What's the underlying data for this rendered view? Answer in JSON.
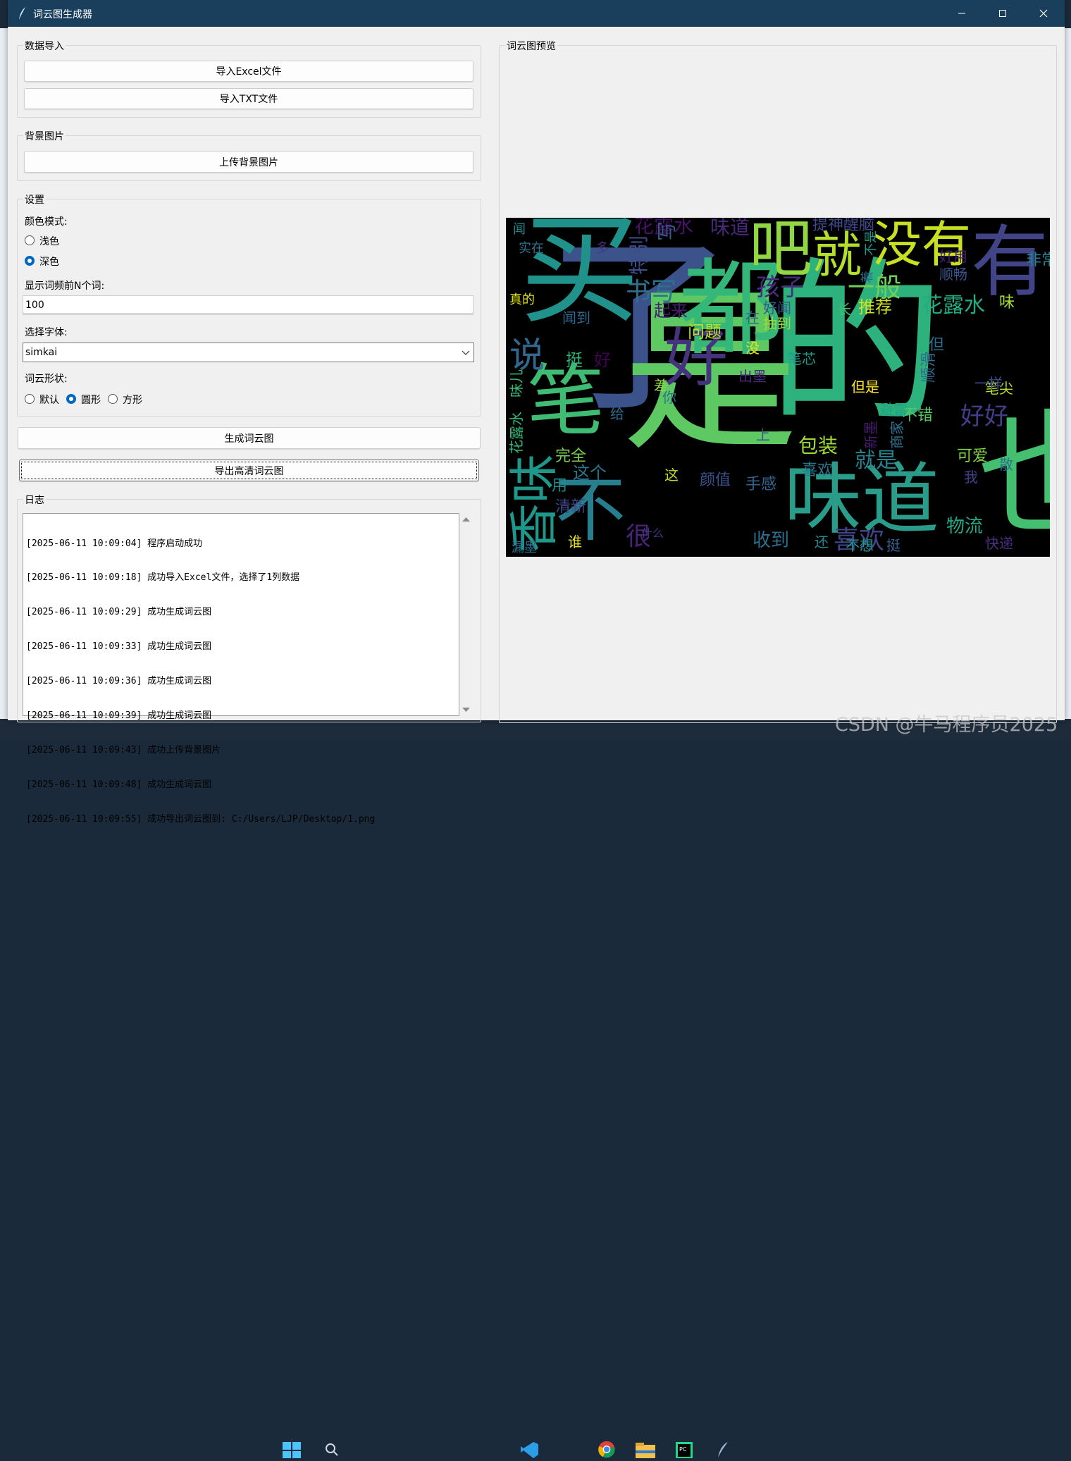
{
  "window": {
    "title": "词云图生成器"
  },
  "import_group": {
    "legend": "数据导入",
    "excel_button": "导入Excel文件",
    "txt_button": "导入TXT文件"
  },
  "bg_group": {
    "legend": "背景图片",
    "upload_button": "上传背景图片"
  },
  "settings": {
    "legend": "设置",
    "color_mode_label": "颜色模式:",
    "color_options": [
      {
        "label": "浅色",
        "selected": false
      },
      {
        "label": "深色",
        "selected": true
      }
    ],
    "topn_label": "显示词频前N个词:",
    "topn_value": "100",
    "font_label": "选择字体:",
    "font_value": "simkai",
    "shape_label": "词云形状:",
    "shape_options": [
      {
        "label": "默认",
        "selected": false
      },
      {
        "label": "圆形",
        "selected": true
      },
      {
        "label": "方形",
        "selected": false
      }
    ]
  },
  "actions": {
    "generate_button": "生成词云图",
    "export_button": "导出高清词云图"
  },
  "log": {
    "legend": "日志",
    "lines": [
      "[2025-06-11 10:09:04] 程序启动成功",
      "[2025-06-11 10:09:18] 成功导入Excel文件，选择了1列数据",
      "[2025-06-11 10:09:29] 成功生成词云图",
      "[2025-06-11 10:09:33] 成功生成词云图",
      "[2025-06-11 10:09:36] 成功生成词云图",
      "[2025-06-11 10:09:39] 成功生成词云图",
      "[2025-06-11 10:09:43] 成功上传背景图片",
      "[2025-06-11 10:09:48] 成功生成词云图",
      "[2025-06-11 10:09:55] 成功导出词云图到: C:/Users/LJP/Desktop/1.png"
    ]
  },
  "preview": {
    "legend": "词云图预览",
    "words": [
      {
        "t": "的",
        "c": "#2db27d"
      },
      {
        "t": "了",
        "c": "#3b528b"
      },
      {
        "t": "买",
        "c": "#21918c"
      },
      {
        "t": "是",
        "c": "#5ec962"
      },
      {
        "t": "都",
        "c": "#35b779"
      },
      {
        "t": "吧",
        "c": "#90d743"
      },
      {
        "t": "就",
        "c": "#b5de2b"
      },
      {
        "t": "没有",
        "c": "#c8e020"
      },
      {
        "t": "有",
        "c": "#414487"
      },
      {
        "t": "味道",
        "c": "#2a9d8a"
      },
      {
        "t": "笔",
        "c": "#3fbc73"
      },
      {
        "t": "不",
        "c": "#277f8e"
      },
      {
        "t": "也",
        "c": "#44bf70"
      },
      {
        "t": "好",
        "c": "#46337e"
      },
      {
        "t": "说",
        "c": "#31688e"
      },
      {
        "t": "香味",
        "c": "#1f988b"
      },
      {
        "t": "书写",
        "c": "#2c728e"
      },
      {
        "t": "孩子",
        "c": "#472d7b"
      },
      {
        "t": "一般",
        "c": "#6ece58"
      },
      {
        "t": "喜欢",
        "c": "#404688"
      },
      {
        "t": "花露水",
        "c": "#471365"
      },
      {
        "t": "味道",
        "c": "#482878"
      },
      {
        "t": "花露水",
        "c": "#25ab82"
      },
      {
        "t": "提神醒脑",
        "c": "#3e4989"
      },
      {
        "t": "推荐",
        "c": "#d0e11c"
      },
      {
        "t": "包装",
        "c": "#a2da37"
      },
      {
        "t": "就是",
        "c": "#26828e"
      },
      {
        "t": "物流",
        "c": "#22a884"
      },
      {
        "t": "收到",
        "c": "#2e6f8e"
      },
      {
        "t": "很",
        "c": "#482475"
      },
      {
        "t": "好好",
        "c": "#433e85"
      },
      {
        "t": "可爱",
        "c": "#86d549"
      },
      {
        "t": "颜值",
        "c": "#3b528b"
      },
      {
        "t": "手感",
        "c": "#33638d"
      },
      {
        "t": "喜欢",
        "c": "#29798e"
      },
      {
        "t": "完全",
        "c": "#7ad151"
      },
      {
        "t": "这个",
        "c": "#2a788e"
      },
      {
        "t": "清新",
        "c": "#3f4788"
      },
      {
        "t": "挺",
        "c": "#31b57b"
      },
      {
        "t": "好",
        "c": "#440154"
      },
      {
        "t": "问题",
        "c": "#bddf26"
      },
      {
        "t": "起来",
        "c": "#481f70"
      },
      {
        "t": "闻到",
        "c": "#306a8e"
      },
      {
        "t": "真的",
        "c": "#dfe318"
      },
      {
        "t": "实在",
        "c": "#2b748e"
      },
      {
        "t": "闻",
        "c": "#23888e"
      },
      {
        "t": "多",
        "c": "#453781"
      },
      {
        "t": "笔芯",
        "c": "#1e9b8a"
      },
      {
        "t": "但是",
        "c": "#fde725"
      },
      {
        "t": "笔尖",
        "c": "#b8de29"
      },
      {
        "t": "不错",
        "c": "#56c667"
      },
      {
        "t": "避雷",
        "c": "#20a486"
      },
      {
        "t": "顺滑",
        "c": "#2f6c8e"
      },
      {
        "t": "特别",
        "c": "#3d4e8a"
      },
      {
        "t": "写",
        "c": "#38598c"
      },
      {
        "t": "顺畅",
        "c": "#3a548c"
      },
      {
        "t": "好用",
        "c": "#482071"
      },
      {
        "t": "抽到",
        "c": "#a0da39"
      },
      {
        "t": "好闻",
        "c": "#39568c"
      },
      {
        "t": "长",
        "c": "#42be71"
      },
      {
        "t": "在",
        "c": "#32658e"
      },
      {
        "t": "谁",
        "c": "#e5e419"
      },
      {
        "t": "还",
        "c": "#24868e"
      },
      {
        "t": "不想",
        "c": "#1f958b"
      },
      {
        "t": "挺",
        "c": "#34618d"
      },
      {
        "t": "快递",
        "c": "#472f7d"
      },
      {
        "t": "漏墨",
        "c": "#2c718e"
      },
      {
        "t": "这",
        "c": "#c0df25"
      },
      {
        "t": "上",
        "c": "#3b518b"
      },
      {
        "t": "给",
        "c": "#2f6b8e"
      },
      {
        "t": "差",
        "c": "#93d741"
      },
      {
        "t": "你",
        "c": "#2b758e"
      },
      {
        "t": "出墨",
        "c": "#482677"
      },
      {
        "t": "味儿",
        "c": "#37b878"
      },
      {
        "t": "花露水",
        "c": "#34b679"
      },
      {
        "t": "着",
        "c": "#2c718e"
      },
      {
        "t": "非常",
        "c": "#25838e"
      },
      {
        "t": "味",
        "c": "#a5db36"
      },
      {
        "t": "用",
        "c": "#218f8d"
      },
      {
        "t": "没",
        "c": "#e2e418"
      },
      {
        "t": "但",
        "c": "#2e6e8e"
      },
      {
        "t": "散",
        "c": "#2b748e"
      },
      {
        "t": "一样",
        "c": "#3c4f8a"
      },
      {
        "t": "新墨",
        "c": "#481c6e"
      },
      {
        "t": "商家",
        "c": "#2d708e"
      },
      {
        "t": "我",
        "c": "#414287"
      },
      {
        "t": "不是",
        "c": "#1f9a8a"
      },
      {
        "t": "什么",
        "c": "#46327e"
      }
    ]
  }
}
